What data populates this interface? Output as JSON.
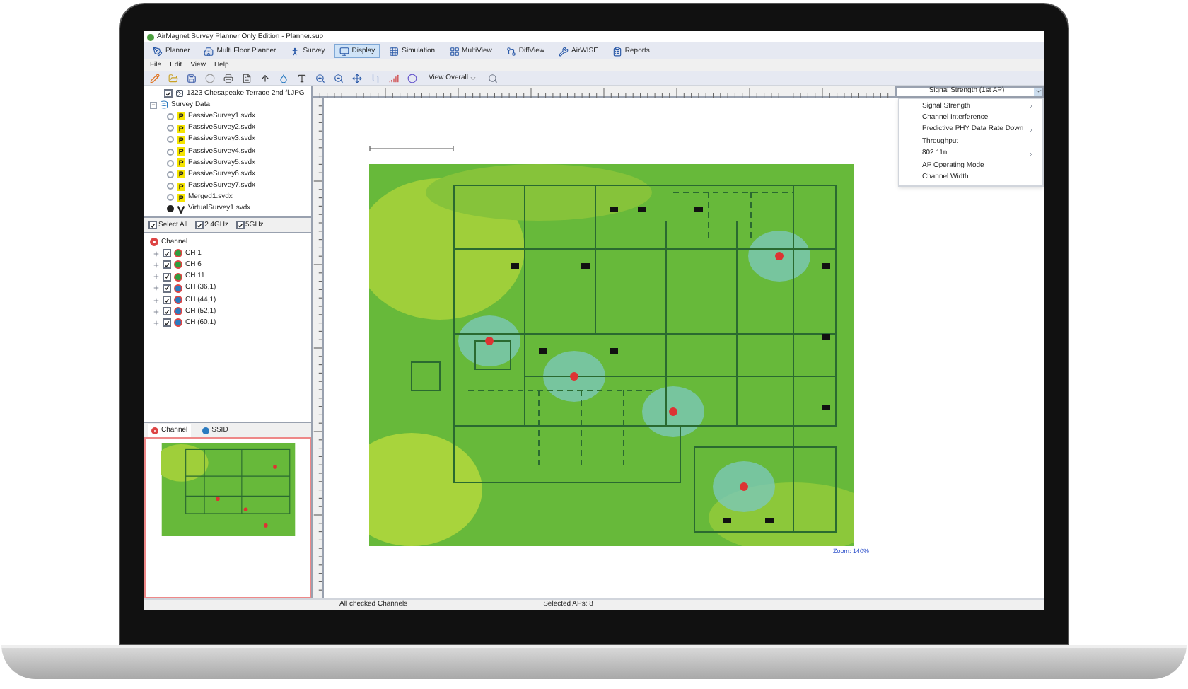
{
  "window": {
    "title": "AirMagnet Survey Planner Only Edition - Planner.sup"
  },
  "tabs": [
    {
      "label": "Planner",
      "selected": false
    },
    {
      "label": "Multi Floor Planner",
      "selected": false
    },
    {
      "label": "Survey",
      "selected": false
    },
    {
      "label": "Display",
      "selected": true
    },
    {
      "label": "Simulation",
      "selected": false
    },
    {
      "label": "MultiView",
      "selected": false
    },
    {
      "label": "DiffView",
      "selected": false
    },
    {
      "label": "AirWISE",
      "selected": false
    },
    {
      "label": "Reports",
      "selected": false
    }
  ],
  "menu": [
    "File",
    "Edit",
    "View",
    "Help"
  ],
  "toolbar": {
    "view_dropdown": "View Overall"
  },
  "project_tree": [
    {
      "label": "1323 Chesapeake Terrace 2nd fl.JPG",
      "kind": "image",
      "checked": true
    },
    {
      "label": "Survey Data",
      "kind": "folder",
      "expanded": true,
      "children": [
        {
          "label": "PassiveSurvey1.svdx",
          "kind": "passive",
          "selected": false
        },
        {
          "label": "PassiveSurvey2.svdx",
          "kind": "passive",
          "selected": false
        },
        {
          "label": "PassiveSurvey3.svdx",
          "kind": "passive",
          "selected": false
        },
        {
          "label": "PassiveSurvey4.svdx",
          "kind": "passive",
          "selected": false
        },
        {
          "label": "PassiveSurvey5.svdx",
          "kind": "passive",
          "selected": false
        },
        {
          "label": "PassiveSurvey6.svdx",
          "kind": "passive",
          "selected": false
        },
        {
          "label": "PassiveSurvey7.svdx",
          "kind": "passive",
          "selected": false
        },
        {
          "label": "Merged1.svdx",
          "kind": "passive",
          "selected": false
        },
        {
          "label": "VirtualSurvey1.svdx",
          "kind": "virtual",
          "selected": true
        }
      ]
    }
  ],
  "band_filters": [
    {
      "label": "Select All",
      "checked": true
    },
    {
      "label": "2.4GHz",
      "checked": true
    },
    {
      "label": "5GHz",
      "checked": true
    }
  ],
  "channel_tree": {
    "label": "Channel",
    "children": [
      {
        "label": "CH 1",
        "checked": true,
        "color": "#2e9e3e"
      },
      {
        "label": "CH 6",
        "checked": true,
        "color": "#2e9e3e"
      },
      {
        "label": "CH 11",
        "checked": true,
        "color": "#2e9e3e"
      },
      {
        "label": "CH (36,1)",
        "checked": true,
        "color": "#2b7bc0"
      },
      {
        "label": "CH (44,1)",
        "checked": true,
        "color": "#2b7bc0"
      },
      {
        "label": "CH (52,1)",
        "checked": true,
        "color": "#2b7bc0"
      },
      {
        "label": "CH (60,1)",
        "checked": true,
        "color": "#2b7bc0"
      }
    ]
  },
  "panel_tabs": [
    {
      "label": "Channel",
      "selected": true
    },
    {
      "label": "SSID",
      "selected": false
    }
  ],
  "display_dropdown": {
    "value": "Signal Strength (1st AP)",
    "expanded": true,
    "options": [
      {
        "label": "Signal Strength",
        "submenu": true
      },
      {
        "label": "Channel Interference",
        "submenu": false
      },
      {
        "label": "Predictive PHY Data Rate Down",
        "submenu": true
      },
      {
        "label": "Throughput",
        "submenu": false
      },
      {
        "label": "802.11n",
        "submenu": true
      },
      {
        "label": "AP Operating Mode",
        "submenu": false
      },
      {
        "label": "Channel Width",
        "submenu": false
      }
    ]
  },
  "canvas": {
    "zoom": "Zoom: 140%"
  },
  "status_bar": [
    "All checked Channels",
    "Selected APs: 8"
  ]
}
